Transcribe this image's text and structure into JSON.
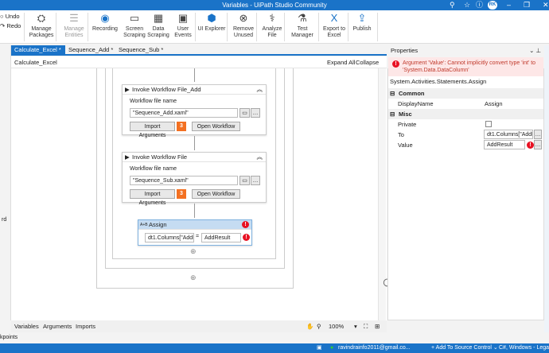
{
  "window": {
    "title": "Variables - UiPath Studio Community",
    "avatar": "RK"
  },
  "ribbon": {
    "undo": "Undo",
    "redo": "Redo",
    "buttons": [
      {
        "label": "Manage Packages",
        "icon": "packages-icon"
      },
      {
        "label": "Manage Entities",
        "icon": "entities-icon",
        "disabled": true
      },
      {
        "label": "Recording",
        "icon": "record-icon"
      },
      {
        "label": "Screen Scraping",
        "icon": "screen-icon"
      },
      {
        "label": "Data Scraping",
        "icon": "data-icon"
      },
      {
        "label": "User Events",
        "icon": "events-icon"
      },
      {
        "label": "UI Explorer",
        "icon": "explorer-icon"
      },
      {
        "label": "Remove Unused",
        "icon": "remove-icon"
      },
      {
        "label": "Analyze File",
        "icon": "stethoscope-icon"
      },
      {
        "label": "Test Manager",
        "icon": "flask-icon"
      },
      {
        "label": "Export to Excel",
        "icon": "excel-icon"
      },
      {
        "label": "Publish",
        "icon": "upload-icon"
      }
    ]
  },
  "tabs": [
    {
      "label": "Calculate_Excel *",
      "active": true
    },
    {
      "label": "Sequence_Add *"
    },
    {
      "label": "Sequence_Sub *"
    }
  ],
  "designer": {
    "breadcrumb": "Calculate_Excel",
    "expand_all": "Expand All",
    "collapse_all": "Collapse All",
    "invoke1": {
      "title": "Invoke Workflow File_Add",
      "field_label": "Workflow file name",
      "value": "\"Sequence_Add.xaml\"",
      "import": "Import Arguments",
      "count": "3",
      "open": "Open Workflow"
    },
    "invoke2": {
      "title": "Invoke Workflow File",
      "field_label": "Workflow file name",
      "value": "\"Sequence_Sub.xaml\"",
      "import": "Import Arguments",
      "count": "3",
      "open": "Open Workflow"
    },
    "assign": {
      "title": "Assign",
      "to": "dt1.Columns[\"AddI",
      "eq": "=",
      "value": "AddResult"
    }
  },
  "bottom": {
    "variables": "Variables",
    "arguments": "Arguments",
    "imports": "Imports",
    "zoom": "100%"
  },
  "breakpoints": "kpoints",
  "left_label": "rd",
  "properties": {
    "header": "Properties",
    "error": "Argument 'Value': Cannot implicitly convert type 'int' to 'System.Data.DataColumn'",
    "type": "System.Activities.Statements.Assign",
    "common": "Common",
    "misc": "Misc",
    "rows": [
      {
        "name": "DisplayName",
        "value": "Assign"
      },
      {
        "name": "Private",
        "value": ""
      },
      {
        "name": "To",
        "value": "dt1.Columns[\"AddR"
      },
      {
        "name": "Value",
        "value": "AddResult"
      }
    ]
  },
  "status": {
    "email": "ravindrainfo2011@gmail.co...",
    "source": "Add To Source Control",
    "lang": "C#, Windows - Legacy"
  },
  "colors": {
    "accent": "#1a73c8",
    "badge": "#f37021",
    "error": "#e81123"
  }
}
